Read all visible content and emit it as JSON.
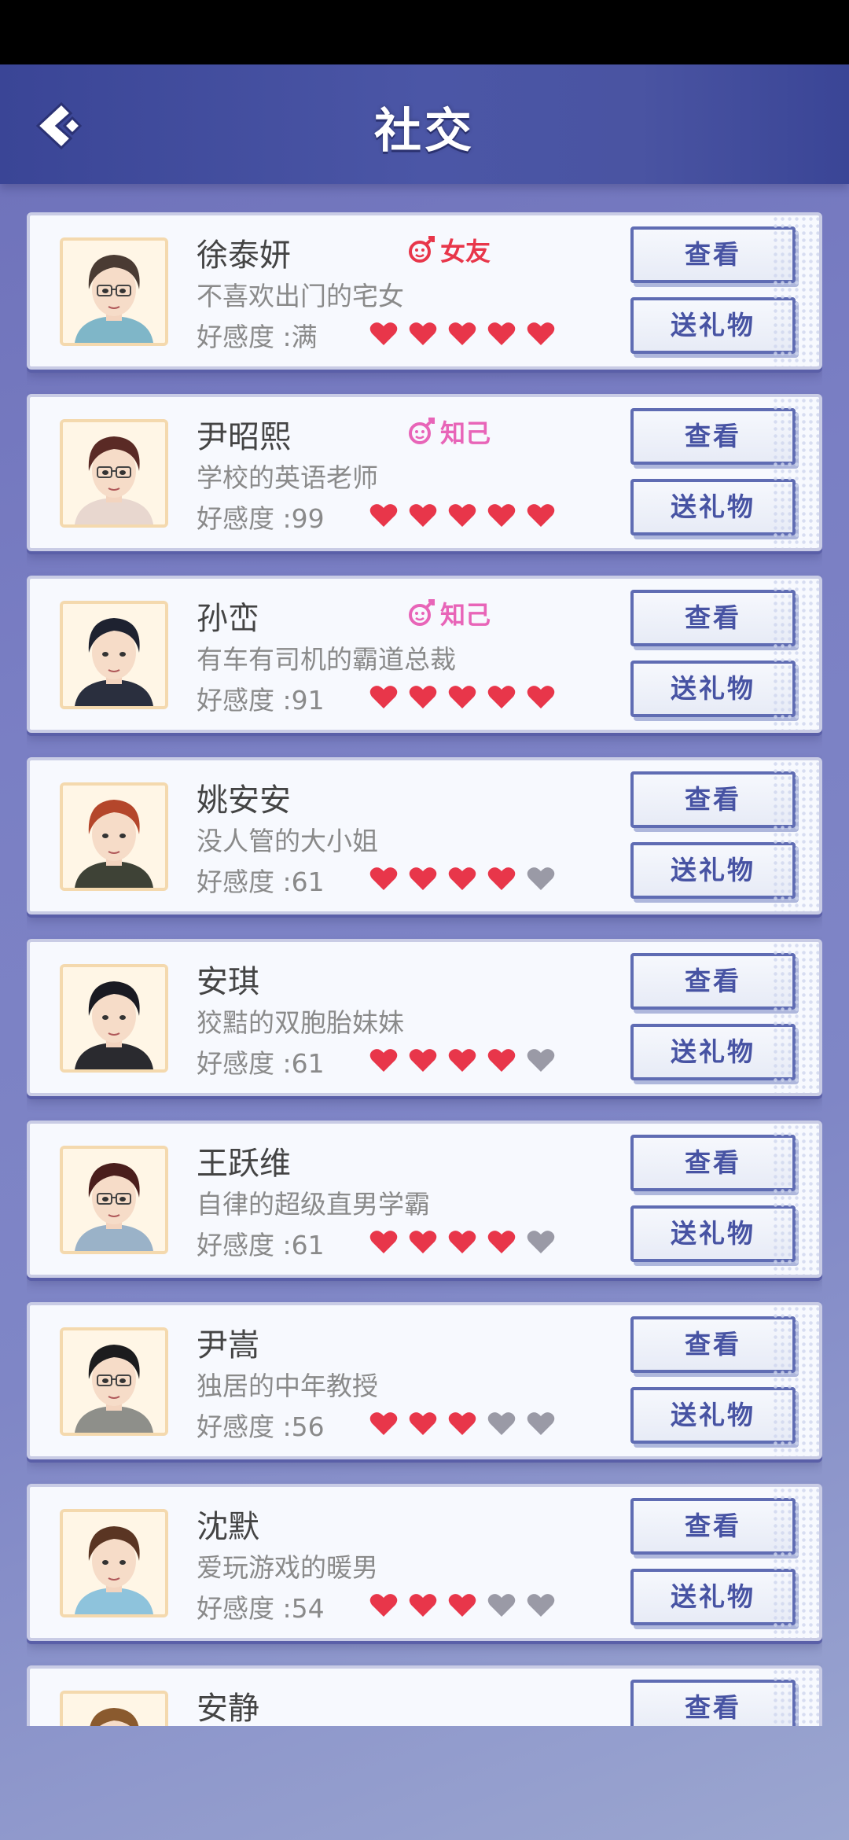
{
  "header": {
    "title": "社交"
  },
  "colors": {
    "heart_on": "#e8364a",
    "heart_off": "#9a9aa6",
    "gf": "#e8364a",
    "friend": "#e865b8",
    "btn_text": "#4753a3"
  },
  "buttons": {
    "view": "查看",
    "gift": "送礼物"
  },
  "favor_label": "好感度 :",
  "characters": [
    {
      "name": "徐泰妍",
      "relation": "女友",
      "relation_type": "gf",
      "desc": "不喜欢出门的宅女",
      "favor": "满",
      "hearts": 5,
      "hair": "#4a3b33",
      "shirt": "#7fb6c8",
      "glasses": true
    },
    {
      "name": "尹昭熙",
      "relation": "知己",
      "relation_type": "friend",
      "desc": "学校的英语老师",
      "favor": "99",
      "hearts": 5,
      "hair": "#5a2a25",
      "shirt": "#e8d7cf",
      "glasses": true
    },
    {
      "name": "孙峦",
      "relation": "知己",
      "relation_type": "friend",
      "desc": "有车有司机的霸道总裁",
      "favor": "91",
      "hearts": 5,
      "hair": "#1e2230",
      "shirt": "#2a2f3e",
      "glasses": false
    },
    {
      "name": "姚安安",
      "relation": "",
      "relation_type": "",
      "desc": "没人管的大小姐",
      "favor": "61",
      "hearts": 4,
      "hair": "#b4462b",
      "shirt": "#3e4236",
      "glasses": false
    },
    {
      "name": "安琪",
      "relation": "",
      "relation_type": "",
      "desc": "狡黠的双胞胎妹妹",
      "favor": "61",
      "hearts": 4,
      "hair": "#1a1a22",
      "shirt": "#2a2a2f",
      "glasses": false
    },
    {
      "name": "王跃维",
      "relation": "",
      "relation_type": "",
      "desc": "自律的超级直男学霸",
      "favor": "61",
      "hearts": 4,
      "hair": "#4a1e1c",
      "shirt": "#9ab2c8",
      "glasses": true
    },
    {
      "name": "尹嵩",
      "relation": "",
      "relation_type": "",
      "desc": "独居的中年教授",
      "favor": "56",
      "hearts": 3,
      "hair": "#1c1c1e",
      "shirt": "#8e8f8a",
      "glasses": true
    },
    {
      "name": "沈默",
      "relation": "",
      "relation_type": "",
      "desc": "爱玩游戏的暖男",
      "favor": "54",
      "hearts": 3,
      "hair": "#5a3523",
      "shirt": "#8ec3dc",
      "glasses": false
    },
    {
      "name": "安静",
      "relation": "",
      "relation_type": "",
      "desc": "",
      "favor": "",
      "hearts": 0,
      "hair": "#8a5a2e",
      "shirt": "#ccc",
      "glasses": false
    }
  ]
}
